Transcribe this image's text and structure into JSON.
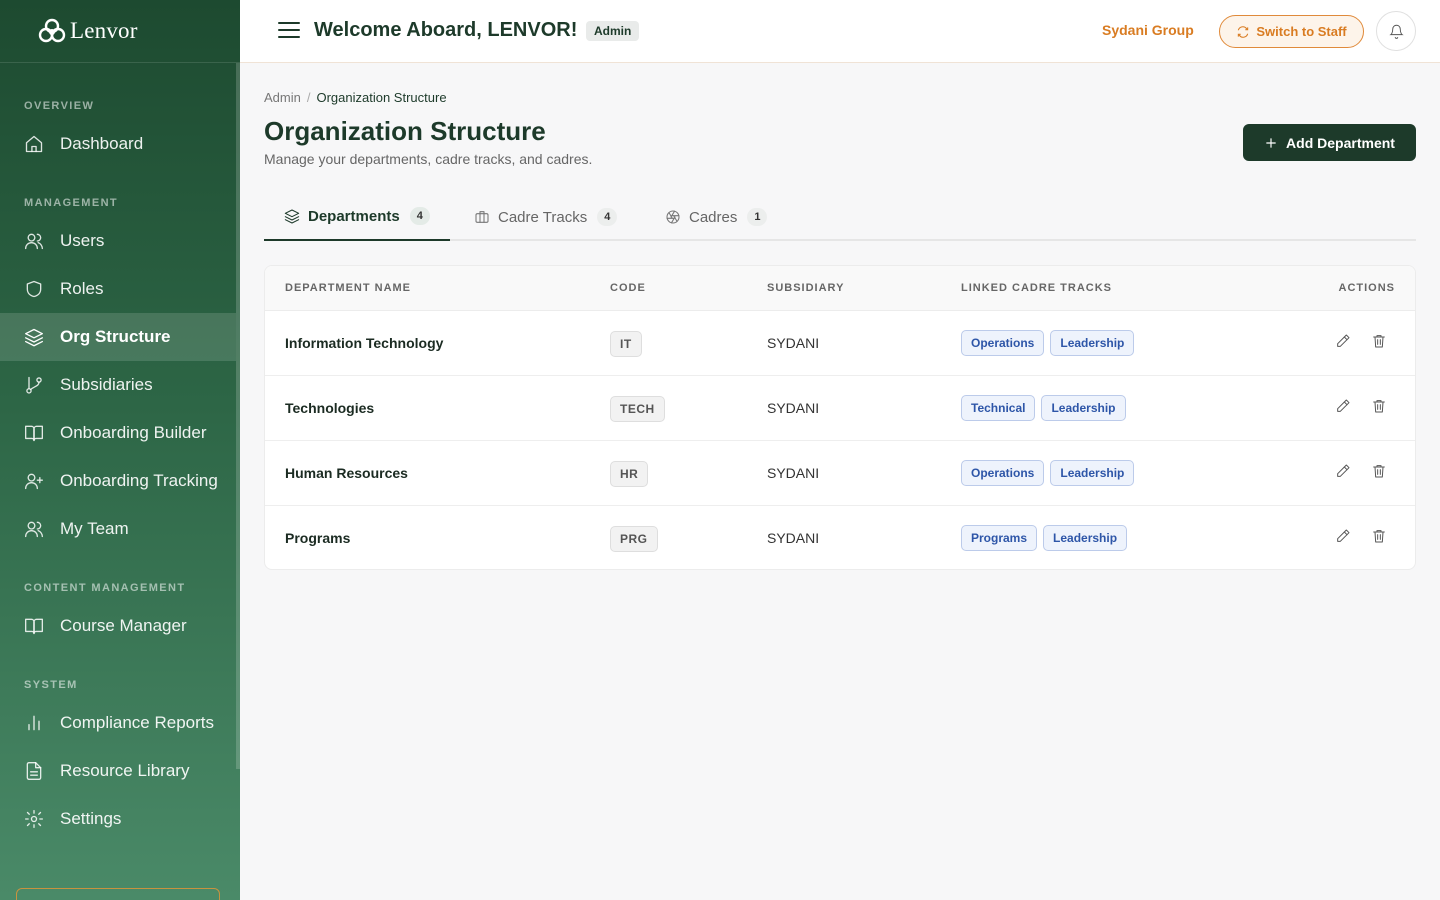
{
  "app": {
    "brand": "Lenvor"
  },
  "sidebar": {
    "sections": {
      "overview": "OVERVIEW",
      "management": "MANAGEMENT",
      "content": "CONTENT MANAGEMENT",
      "system": "SYSTEM"
    },
    "items": [
      {
        "label": "Dashboard",
        "icon": "home-icon"
      },
      {
        "label": "Users",
        "icon": "users-icon"
      },
      {
        "label": "Roles",
        "icon": "shield-icon"
      },
      {
        "label": "Org Structure",
        "icon": "layers-icon",
        "active": true
      },
      {
        "label": "Subsidiaries",
        "icon": "branch-icon"
      },
      {
        "label": "Onboarding Builder",
        "icon": "book-icon"
      },
      {
        "label": "Onboarding Tracking",
        "icon": "user-plus-icon"
      },
      {
        "label": "My Team",
        "icon": "users-icon"
      },
      {
        "label": "Course Manager",
        "icon": "book-icon"
      },
      {
        "label": "Compliance Reports",
        "icon": "bar-chart-icon"
      },
      {
        "label": "Resource Library",
        "icon": "file-icon"
      },
      {
        "label": "Settings",
        "icon": "gear-icon"
      }
    ]
  },
  "header": {
    "welcome": "Welcome Aboard, LENVOR!",
    "role": "Admin",
    "group": "Sydani Group",
    "switch_label": "Switch to Staff"
  },
  "breadcrumb": {
    "root": "Admin",
    "current": "Organization Structure"
  },
  "page": {
    "title": "Organization Structure",
    "subtitle": "Manage your departments, cadre tracks, and cadres.",
    "add_label": "Add Department"
  },
  "tabs": [
    {
      "label": "Departments",
      "count": "4",
      "active": true
    },
    {
      "label": "Cadre Tracks",
      "count": "4"
    },
    {
      "label": "Cadres",
      "count": "1"
    }
  ],
  "table": {
    "headers": [
      "DEPARTMENT NAME",
      "CODE",
      "SUBSIDIARY",
      "LINKED CADRE TRACKS",
      "ACTIONS"
    ],
    "rows": [
      {
        "name": "Information Technology",
        "code": "IT",
        "subsidiary": "SYDANI",
        "tracks": [
          "Operations",
          "Leadership"
        ]
      },
      {
        "name": "Technologies",
        "code": "TECH",
        "subsidiary": "SYDANI",
        "tracks": [
          "Technical",
          "Leadership"
        ]
      },
      {
        "name": "Human Resources",
        "code": "HR",
        "subsidiary": "SYDANI",
        "tracks": [
          "Operations",
          "Leadership"
        ]
      },
      {
        "name": "Programs",
        "code": "PRG",
        "subsidiary": "SYDANI",
        "tracks": [
          "Programs",
          "Leadership"
        ]
      }
    ]
  },
  "colors": {
    "sidebar_top": "#1d4a30",
    "primary": "#1d3a2a",
    "accent_orange": "#d97c22",
    "track_blue": "#2e56a8"
  }
}
